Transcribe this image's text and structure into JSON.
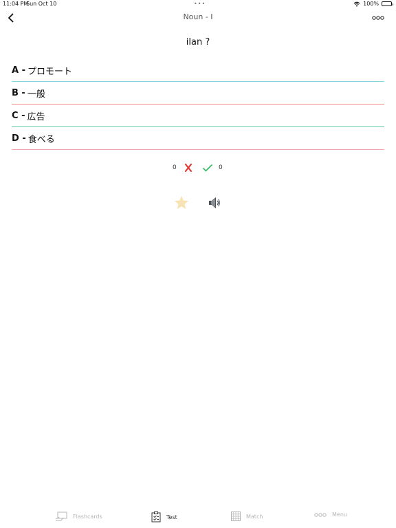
{
  "status": {
    "time": "11:04 PM",
    "date": "Sun Oct 10",
    "battery": "100%"
  },
  "nav": {
    "title": "Noun - I"
  },
  "question": "ilan ?",
  "answers": [
    {
      "letter": "A -",
      "text": "プロモート",
      "color": "#7fd6db"
    },
    {
      "letter": "B -",
      "text": "一般",
      "color": "#ef8a8a"
    },
    {
      "letter": "C -",
      "text": "広告",
      "color": "#55c7a1"
    },
    {
      "letter": "D -",
      "text": "食べる",
      "color": "#f0a8a8"
    }
  ],
  "score": {
    "wrong": "0",
    "right": "0",
    "wrong_color": "#e53935",
    "right_color": "#2ebd59"
  },
  "tabs": [
    {
      "label": "Flashcards",
      "icon": "flashcards-icon"
    },
    {
      "label": "Test",
      "icon": "test-icon",
      "active": true
    },
    {
      "label": "Match",
      "icon": "grid-icon"
    },
    {
      "label": "Menu",
      "icon": "more-dots-icon"
    }
  ]
}
